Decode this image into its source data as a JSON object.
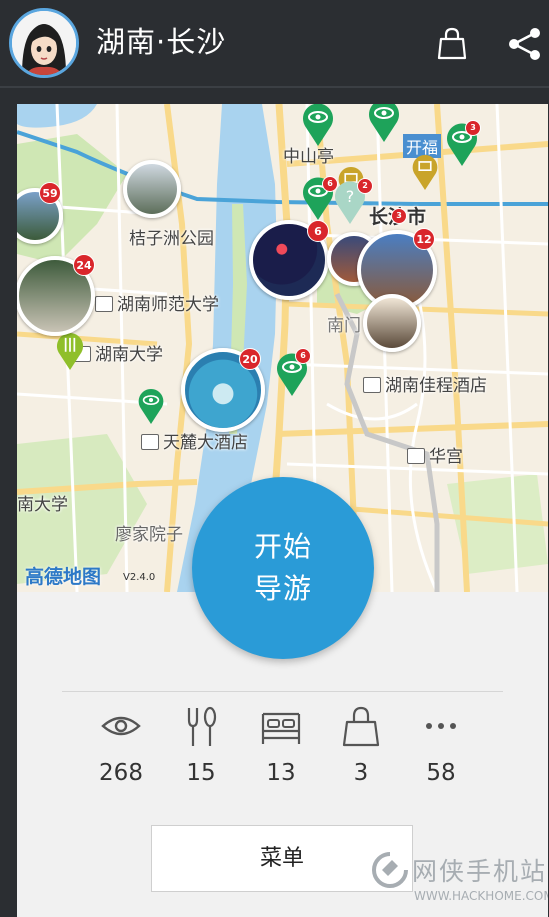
{
  "header": {
    "title": "湖南·长沙",
    "icons": {
      "avatar": "user-avatar",
      "bag": "shopping-bag-icon",
      "share": "share-icon"
    }
  },
  "map": {
    "labels": {
      "zhongshanting": "中山亭",
      "kaifu": "开福",
      "changsha": "长沙市",
      "juzizhou": "桔子洲公园",
      "shida": "湖南师范大学",
      "hunan_univ": "湖南大学",
      "nanmen": "南门",
      "jiacheng": "湖南佳程酒店",
      "tianlu": "天麓大酒店",
      "huagong": "华宫",
      "nandaxue": "南大学",
      "liaojia": "廖家院子"
    },
    "badges": {
      "b59": "59",
      "b24": "24",
      "b20": "20",
      "b6a": "6",
      "b12": "12",
      "b6b": "6",
      "b3a": "3",
      "b3b": "3",
      "b2": "2",
      "b6c": "6"
    },
    "logo": "高德地图",
    "logo_version": "V2.4.0",
    "colors": {
      "water": "#a9d3ef",
      "park": "#cfe7b4",
      "road": "#ffffff",
      "arterial": "#f9d98a",
      "pin_green": "#1ea35a"
    }
  },
  "start_button": {
    "label": "开始\n导游"
  },
  "categories": [
    {
      "icon": "eye-icon",
      "count": "268"
    },
    {
      "icon": "fork-spoon-icon",
      "count": "15"
    },
    {
      "icon": "bed-icon",
      "count": "13"
    },
    {
      "icon": "shopping-bag-icon",
      "count": "3"
    },
    {
      "icon": "more-icon",
      "count": "58"
    }
  ],
  "menu_button": {
    "label": "菜单"
  },
  "watermark": {
    "cn": "网侠手机站",
    "en": "WWW.HACKHOME.COM"
  }
}
